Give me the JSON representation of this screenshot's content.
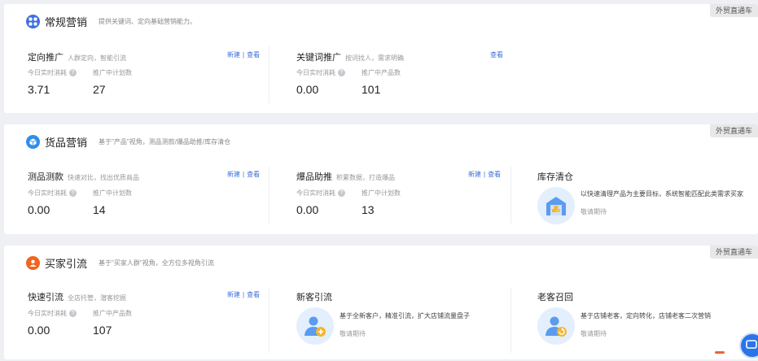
{
  "sections": {
    "regular": {
      "title": "常规营销",
      "desc": "提供关键词、定向基础营销能力。",
      "tag": "外贸直通车",
      "cards": [
        {
          "title": "定向推广",
          "sub": "人群定向，智能引流",
          "new_label": "新建",
          "view_label": "查看",
          "stat1_label": "今日实时消耗",
          "stat1_value": "3.71",
          "stat2_label": "推广中计划数",
          "stat2_value": "27"
        },
        {
          "title": "关键词推广",
          "sub": "按词找人，需求明确",
          "view_label": "查看",
          "stat1_label": "今日实时消耗",
          "stat1_value": "0.00",
          "stat2_label": "推广中产品数",
          "stat2_value": "101"
        }
      ]
    },
    "goods": {
      "title": "货品营销",
      "desc": "基于\"产品\"视角，测品测款/爆品助推/库存清仓",
      "tag": "外贸直通车",
      "cards": [
        {
          "title": "测品测款",
          "sub": "快速对比，找出优质商品",
          "new_label": "新建",
          "view_label": "查看",
          "stat1_label": "今日实时消耗",
          "stat1_value": "0.00",
          "stat2_label": "推广中计划数",
          "stat2_value": "14"
        },
        {
          "title": "爆品助推",
          "sub": "积累数据，打造爆品",
          "new_label": "新建",
          "view_label": "查看",
          "stat1_label": "今日实时消耗",
          "stat1_value": "0.00",
          "stat2_label": "推广中计划数",
          "stat2_value": "13"
        },
        {
          "title": "库存清仓",
          "desc": "以快速清理产品为主要目标，系统智能匹配此类需求买家",
          "soon": "敬请期待",
          "icon": "warehouse-icon"
        }
      ]
    },
    "buyer": {
      "title": "买家引流",
      "desc": "基于\"买家人群\"视角，全方位多视角引流",
      "tag": "外贸直通车",
      "cards": [
        {
          "title": "快速引流",
          "sub": "全店托管，潜客挖掘",
          "new_label": "新建",
          "view_label": "查看",
          "stat1_label": "今日实时消耗",
          "stat1_value": "0.00",
          "stat2_label": "推广中产品数",
          "stat2_value": "107"
        },
        {
          "title": "新客引流",
          "desc": "基于全新客户，精准引流，扩大店铺流量盘子",
          "soon": "敬请期待",
          "icon": "add-user-icon"
        },
        {
          "title": "老客召回",
          "desc": "基于店铺老客，定向转化，店铺老客二次营销",
          "soon": "敬请期待",
          "icon": "recall-user-icon"
        }
      ]
    }
  },
  "help_glyph": "?",
  "colors": {
    "accent": "#3a6fd8",
    "regular_icon": "#3d6fe0",
    "goods_icon": "#2f8ee8",
    "buyer_icon": "#f0651e",
    "feature_bg": "#e3effd"
  }
}
